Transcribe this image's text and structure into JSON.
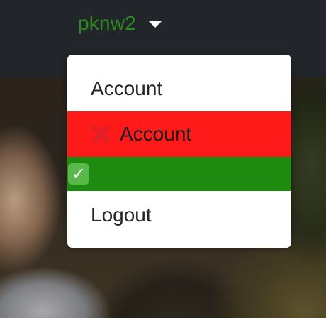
{
  "navbar": {
    "username": "pknw2",
    "username_color": "#2a8a1e",
    "caret_icon": "caret-down-icon"
  },
  "dropdown": {
    "items": [
      {
        "label": "Account"
      },
      {
        "label": "Account",
        "icon": "cross-mark-icon",
        "background": "#ff1a1a"
      },
      {
        "label": "",
        "icon": "check-mark-icon",
        "background": "#1e8a10"
      },
      {
        "label": "Logout"
      }
    ]
  }
}
